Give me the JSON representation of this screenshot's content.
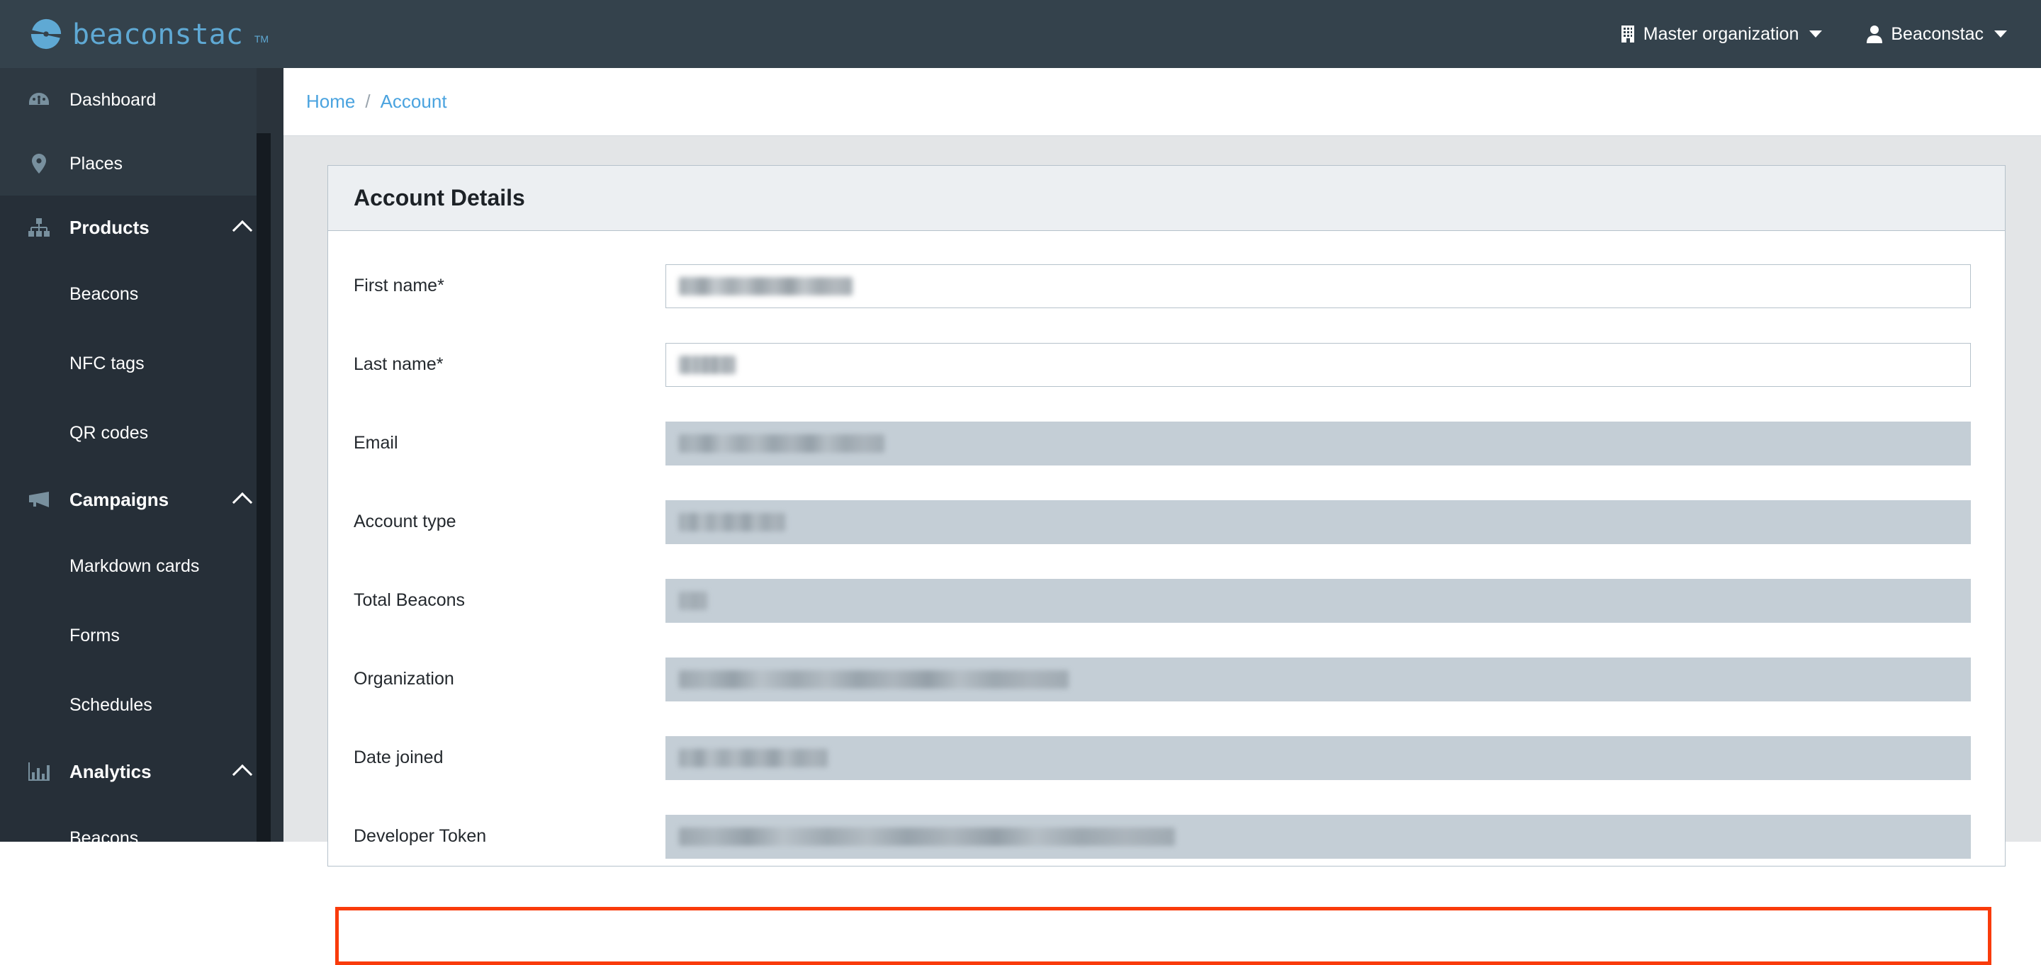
{
  "topbar": {
    "brand_name": "beaconstac",
    "brand_tm": "TM",
    "brand_logo_icon": "beaconstac-pinwheel-logo",
    "org_switcher": {
      "icon": "building-icon",
      "label": "Master organization",
      "caret": "chevron-down-icon"
    },
    "user_menu": {
      "icon": "user-icon",
      "label": "Beaconstac",
      "caret": "chevron-down-icon"
    }
  },
  "sidebar": {
    "items": [
      {
        "label": "Dashboard",
        "icon": "dashboard-gauge-icon",
        "type": "link",
        "group": "top"
      },
      {
        "label": "Places",
        "icon": "map-pin-icon",
        "type": "link",
        "group": "top"
      },
      {
        "label": "Products",
        "icon": "sitemap-icon",
        "type": "section",
        "expanded": true,
        "chevron": "chevron-up-icon"
      },
      {
        "label": "Beacons",
        "type": "sub",
        "parent": "Products"
      },
      {
        "label": "NFC tags",
        "type": "sub",
        "parent": "Products"
      },
      {
        "label": "QR codes",
        "type": "sub",
        "parent": "Products"
      },
      {
        "label": "Campaigns",
        "icon": "megaphone-icon",
        "type": "section",
        "expanded": true,
        "chevron": "chevron-up-icon"
      },
      {
        "label": "Markdown cards",
        "type": "sub",
        "parent": "Campaigns"
      },
      {
        "label": "Forms",
        "type": "sub",
        "parent": "Campaigns"
      },
      {
        "label": "Schedules",
        "type": "sub",
        "parent": "Campaigns"
      },
      {
        "label": "Analytics",
        "icon": "bar-chart-icon",
        "type": "section",
        "expanded": true,
        "chevron": "chevron-up-icon"
      },
      {
        "label": "Beacons",
        "type": "sub",
        "parent": "Analytics"
      }
    ]
  },
  "breadcrumb": {
    "home": "Home",
    "separator": "/",
    "current": "Account"
  },
  "card": {
    "title": "Account Details",
    "fields": [
      {
        "label": "First name*",
        "value": "",
        "readonly": false,
        "redacted": true,
        "redaction_width": 95
      },
      {
        "label": "Last name*",
        "value": "",
        "readonly": false,
        "redacted": true,
        "redaction_width": 50
      },
      {
        "label": "Email",
        "value": "",
        "readonly": true,
        "redacted": true,
        "redaction_width": 165
      },
      {
        "label": "Account type",
        "value": "",
        "readonly": true,
        "redacted": true,
        "redaction_width": 100
      },
      {
        "label": "Total Beacons",
        "value": "",
        "readonly": true,
        "redacted": true,
        "redaction_width": 28
      },
      {
        "label": "Organization",
        "value": "",
        "readonly": true,
        "redacted": true,
        "redaction_width": 305
      },
      {
        "label": "Date joined",
        "value": "",
        "readonly": true,
        "redacted": true,
        "redaction_width": 135
      },
      {
        "label": "Developer Token",
        "value": "",
        "readonly": true,
        "redacted": true,
        "redaction_width": 360,
        "highlighted": true
      }
    ]
  },
  "annotation": {
    "type": "highlight-rectangle",
    "color": "#f93b0b",
    "target_field": "Developer Token"
  }
}
